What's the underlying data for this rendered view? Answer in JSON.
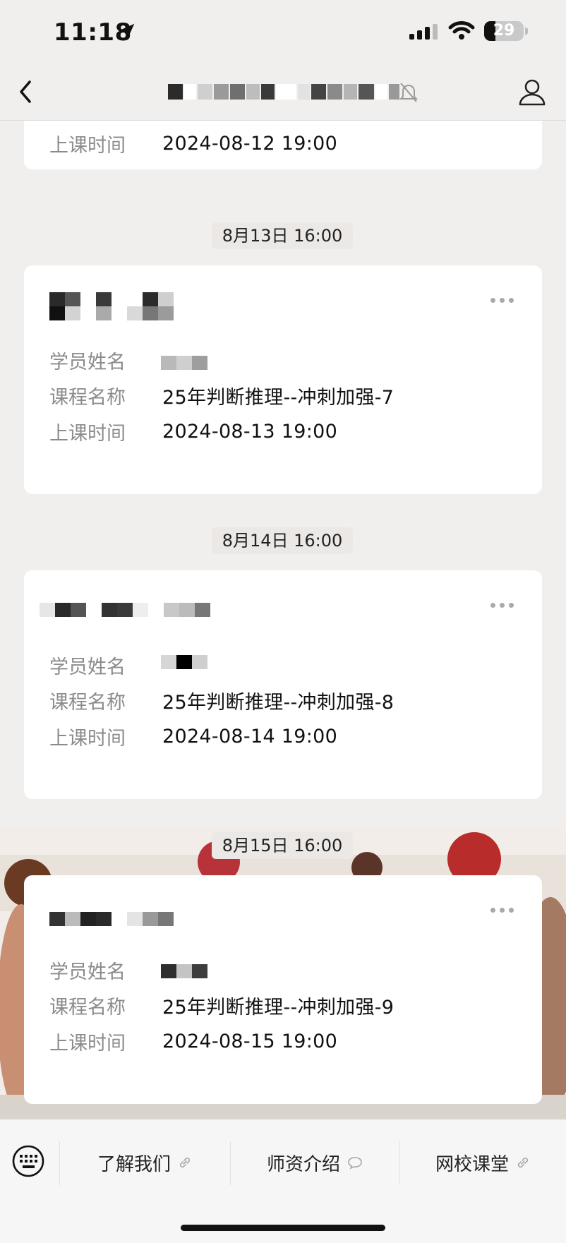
{
  "status_bar": {
    "time": "11:18",
    "battery": "29",
    "battery_level": 0.29
  },
  "chat": {
    "title": ""
  },
  "cards": [
    {
      "sender": "",
      "rows": [
        {
          "label": "上课时间",
          "value": "2024-08-12 19:00"
        }
      ]
    },
    {
      "timestamp": "8月13日 16:00",
      "sender": "",
      "rows": [
        {
          "label": "学员姓名",
          "value": ""
        },
        {
          "label": "课程名称",
          "value": "25年判断推理--冲刺加强-7"
        },
        {
          "label": "上课时间",
          "value": "2024-08-13 19:00"
        }
      ]
    },
    {
      "timestamp": "8月14日 16:00",
      "sender": "",
      "rows": [
        {
          "label": "学员姓名",
          "value": ""
        },
        {
          "label": "课程名称",
          "value": "25年判断推理--冲刺加强-8"
        },
        {
          "label": "上课时间",
          "value": "2024-08-14 19:00"
        }
      ]
    },
    {
      "timestamp": "8月15日 16:00",
      "sender": "",
      "rows": [
        {
          "label": "学员姓名",
          "value": ""
        },
        {
          "label": "课程名称",
          "value": "25年判断推理--冲刺加强-9"
        },
        {
          "label": "上课时间",
          "value": "2024-08-15 19:00"
        }
      ]
    }
  ],
  "bottom_menu": {
    "items": [
      {
        "label": "了解我们",
        "icon": "link-icon"
      },
      {
        "label": "师资介绍",
        "icon": "chat-bubble-icon"
      },
      {
        "label": "网校课堂",
        "icon": "link-icon"
      }
    ]
  },
  "colors": {
    "background": "#f1efee",
    "card": "#ffffff",
    "label": "#8b8b8b"
  }
}
